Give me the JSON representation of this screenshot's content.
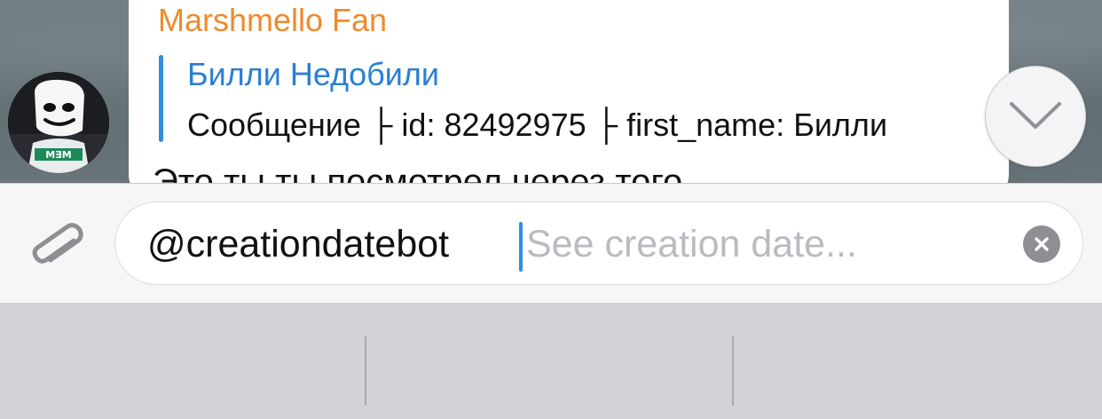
{
  "message": {
    "sender_name": "Marshmello Fan",
    "forward": {
      "author": "Билли Недобили",
      "preview": "Сообщение    ├ id: 82492975    ├ first_name: Билли"
    },
    "text": "Это ты ты посмотрел через того"
  },
  "composer": {
    "value": "@creationdatebot",
    "placeholder": "See creation date..."
  },
  "keyboard": {
    "suggestions": [
      "",
      "",
      ""
    ]
  },
  "colors": {
    "sender": "#ef8a2c",
    "forward_accent": "#2f8ee0",
    "caret": "#2f8ee0",
    "placeholder": "#b9bbc0"
  },
  "icons": {
    "avatar": "marshmello-avatar",
    "scroll": "chevron-down-icon",
    "attach": "paperclip-icon",
    "clear": "clear-circle-icon"
  }
}
